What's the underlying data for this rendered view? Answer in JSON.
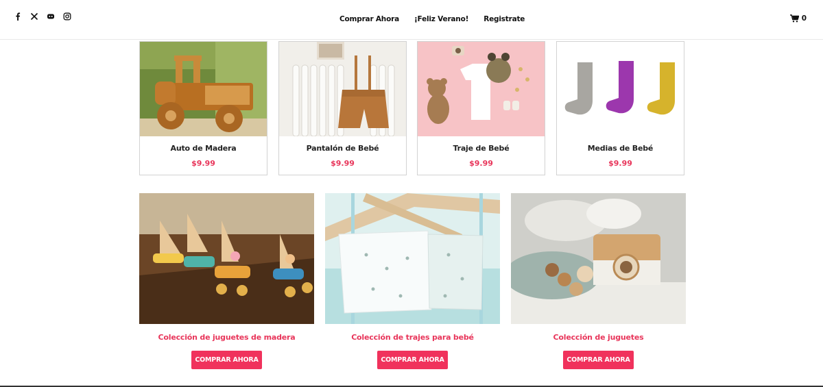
{
  "header": {
    "social_icons": [
      "facebook-icon",
      "x-icon",
      "discord-icon",
      "instagram-icon"
    ],
    "nav": [
      {
        "label": "Comprar Ahora"
      },
      {
        "label": "¡Feliz Verano!"
      },
      {
        "label": "Registrate"
      }
    ],
    "cart": {
      "icon": "cart-icon",
      "count": "0"
    }
  },
  "products": [
    {
      "name": "Auto de Madera",
      "price": "$9.99"
    },
    {
      "name": "Pantalón de Bebé",
      "price": "$9.99"
    },
    {
      "name": "Traje de Bebé",
      "price": "$9.99"
    },
    {
      "name": "Medias de Bebé",
      "price": "$9.99"
    }
  ],
  "collections": [
    {
      "title": "Colección de juguetes de madera",
      "button": "COMPRAR AHORA"
    },
    {
      "title": "Colección de trajes para bebé",
      "button": "COMPRAR AHORA"
    },
    {
      "title": "Colección de juguetes",
      "button": "COMPRAR AHORA"
    }
  ],
  "colors": {
    "accent": "#f0325c",
    "price": "#e8355a",
    "text": "#222222"
  }
}
